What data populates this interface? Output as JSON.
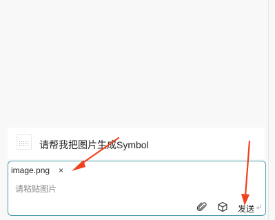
{
  "conversation": {
    "message_text": "请帮我把图片生成Symbol"
  },
  "composer": {
    "attachment_name": "image.png",
    "attachment_remove": "×",
    "placeholder": "请粘贴图片",
    "send_label": "发送"
  },
  "icons": {
    "attach": "paperclip-icon",
    "model": "cube-icon",
    "enter": "enter-key-icon"
  },
  "colors": {
    "composer_border": "#4a9eaa",
    "annotation_arrow": "#f0401e"
  }
}
